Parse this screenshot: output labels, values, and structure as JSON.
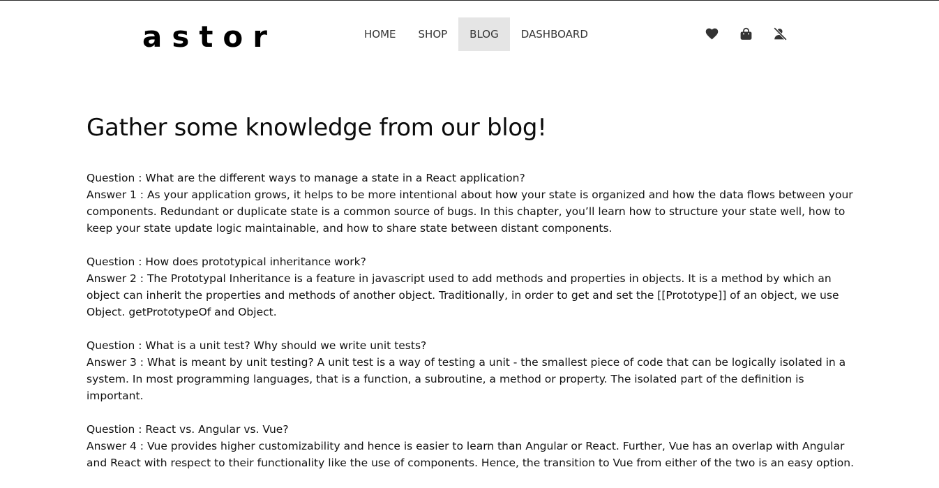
{
  "header": {
    "brand": "astor",
    "nav": [
      {
        "label": "HOME",
        "active": false
      },
      {
        "label": "SHOP",
        "active": false
      },
      {
        "label": "BLOG",
        "active": true
      },
      {
        "label": "DASHBOARD",
        "active": false
      }
    ],
    "icons": [
      "heart-icon",
      "shopping-bag-icon",
      "user-slash-icon"
    ],
    "icon_color": "#333333"
  },
  "main": {
    "title": "Gather some knowledge from our blog!",
    "qa": [
      {
        "question": "Question : What are the different ways to manage a state in a React application?",
        "answer": "Answer 1 : As your application grows, it helps to be more intentional about how your state is organized and how the data flows between your components. Redundant or duplicate state is a common source of bugs. In this chapter, you’ll learn how to structure your state well, how to keep your state update logic maintainable, and how to share state between distant components."
      },
      {
        "question": "Question : How does prototypical inheritance work?",
        "answer": "Answer 2 : The Prototypal Inheritance is a feature in javascript used to add methods and properties in objects. It is a method by which an object can inherit the properties and methods of another object. Traditionally, in order to get and set the [[Prototype]] of an object, we use Object. getPrototypeOf and Object."
      },
      {
        "question": "Question : What is a unit test? Why should we write unit tests?",
        "answer": "Answer 3 : What is meant by unit testing? A unit test is a way of testing a unit - the smallest piece of code that can be logically isolated in a system. In most programming languages, that is a function, a subroutine, a method or property. The isolated part of the definition is important."
      },
      {
        "question": "Question : React vs. Angular vs. Vue?",
        "answer": "Answer 4 : Vue provides higher customizability and hence is easier to learn than Angular or React. Further, Vue has an overlap with Angular and React with respect to their functionality like the use of components. Hence, the transition to Vue from either of the two is an easy option."
      }
    ]
  }
}
